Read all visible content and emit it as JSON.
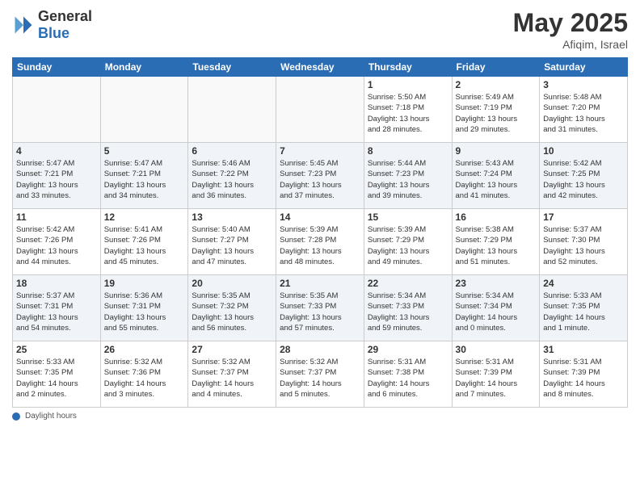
{
  "logo": {
    "general": "General",
    "blue": "Blue"
  },
  "title": {
    "month_year": "May 2025",
    "location": "Afiqim, Israel"
  },
  "days_of_week": [
    "Sunday",
    "Monday",
    "Tuesday",
    "Wednesday",
    "Thursday",
    "Friday",
    "Saturday"
  ],
  "footer": {
    "label": "Daylight hours"
  },
  "weeks": [
    [
      {
        "day": "",
        "info": ""
      },
      {
        "day": "",
        "info": ""
      },
      {
        "day": "",
        "info": ""
      },
      {
        "day": "",
        "info": ""
      },
      {
        "day": "1",
        "info": "Sunrise: 5:50 AM\nSunset: 7:18 PM\nDaylight: 13 hours\nand 28 minutes."
      },
      {
        "day": "2",
        "info": "Sunrise: 5:49 AM\nSunset: 7:19 PM\nDaylight: 13 hours\nand 29 minutes."
      },
      {
        "day": "3",
        "info": "Sunrise: 5:48 AM\nSunset: 7:20 PM\nDaylight: 13 hours\nand 31 minutes."
      }
    ],
    [
      {
        "day": "4",
        "info": "Sunrise: 5:47 AM\nSunset: 7:21 PM\nDaylight: 13 hours\nand 33 minutes."
      },
      {
        "day": "5",
        "info": "Sunrise: 5:47 AM\nSunset: 7:21 PM\nDaylight: 13 hours\nand 34 minutes."
      },
      {
        "day": "6",
        "info": "Sunrise: 5:46 AM\nSunset: 7:22 PM\nDaylight: 13 hours\nand 36 minutes."
      },
      {
        "day": "7",
        "info": "Sunrise: 5:45 AM\nSunset: 7:23 PM\nDaylight: 13 hours\nand 37 minutes."
      },
      {
        "day": "8",
        "info": "Sunrise: 5:44 AM\nSunset: 7:23 PM\nDaylight: 13 hours\nand 39 minutes."
      },
      {
        "day": "9",
        "info": "Sunrise: 5:43 AM\nSunset: 7:24 PM\nDaylight: 13 hours\nand 41 minutes."
      },
      {
        "day": "10",
        "info": "Sunrise: 5:42 AM\nSunset: 7:25 PM\nDaylight: 13 hours\nand 42 minutes."
      }
    ],
    [
      {
        "day": "11",
        "info": "Sunrise: 5:42 AM\nSunset: 7:26 PM\nDaylight: 13 hours\nand 44 minutes."
      },
      {
        "day": "12",
        "info": "Sunrise: 5:41 AM\nSunset: 7:26 PM\nDaylight: 13 hours\nand 45 minutes."
      },
      {
        "day": "13",
        "info": "Sunrise: 5:40 AM\nSunset: 7:27 PM\nDaylight: 13 hours\nand 47 minutes."
      },
      {
        "day": "14",
        "info": "Sunrise: 5:39 AM\nSunset: 7:28 PM\nDaylight: 13 hours\nand 48 minutes."
      },
      {
        "day": "15",
        "info": "Sunrise: 5:39 AM\nSunset: 7:29 PM\nDaylight: 13 hours\nand 49 minutes."
      },
      {
        "day": "16",
        "info": "Sunrise: 5:38 AM\nSunset: 7:29 PM\nDaylight: 13 hours\nand 51 minutes."
      },
      {
        "day": "17",
        "info": "Sunrise: 5:37 AM\nSunset: 7:30 PM\nDaylight: 13 hours\nand 52 minutes."
      }
    ],
    [
      {
        "day": "18",
        "info": "Sunrise: 5:37 AM\nSunset: 7:31 PM\nDaylight: 13 hours\nand 54 minutes."
      },
      {
        "day": "19",
        "info": "Sunrise: 5:36 AM\nSunset: 7:31 PM\nDaylight: 13 hours\nand 55 minutes."
      },
      {
        "day": "20",
        "info": "Sunrise: 5:35 AM\nSunset: 7:32 PM\nDaylight: 13 hours\nand 56 minutes."
      },
      {
        "day": "21",
        "info": "Sunrise: 5:35 AM\nSunset: 7:33 PM\nDaylight: 13 hours\nand 57 minutes."
      },
      {
        "day": "22",
        "info": "Sunrise: 5:34 AM\nSunset: 7:33 PM\nDaylight: 13 hours\nand 59 minutes."
      },
      {
        "day": "23",
        "info": "Sunrise: 5:34 AM\nSunset: 7:34 PM\nDaylight: 14 hours\nand 0 minutes."
      },
      {
        "day": "24",
        "info": "Sunrise: 5:33 AM\nSunset: 7:35 PM\nDaylight: 14 hours\nand 1 minute."
      }
    ],
    [
      {
        "day": "25",
        "info": "Sunrise: 5:33 AM\nSunset: 7:35 PM\nDaylight: 14 hours\nand 2 minutes."
      },
      {
        "day": "26",
        "info": "Sunrise: 5:32 AM\nSunset: 7:36 PM\nDaylight: 14 hours\nand 3 minutes."
      },
      {
        "day": "27",
        "info": "Sunrise: 5:32 AM\nSunset: 7:37 PM\nDaylight: 14 hours\nand 4 minutes."
      },
      {
        "day": "28",
        "info": "Sunrise: 5:32 AM\nSunset: 7:37 PM\nDaylight: 14 hours\nand 5 minutes."
      },
      {
        "day": "29",
        "info": "Sunrise: 5:31 AM\nSunset: 7:38 PM\nDaylight: 14 hours\nand 6 minutes."
      },
      {
        "day": "30",
        "info": "Sunrise: 5:31 AM\nSunset: 7:39 PM\nDaylight: 14 hours\nand 7 minutes."
      },
      {
        "day": "31",
        "info": "Sunrise: 5:31 AM\nSunset: 7:39 PM\nDaylight: 14 hours\nand 8 minutes."
      }
    ]
  ]
}
